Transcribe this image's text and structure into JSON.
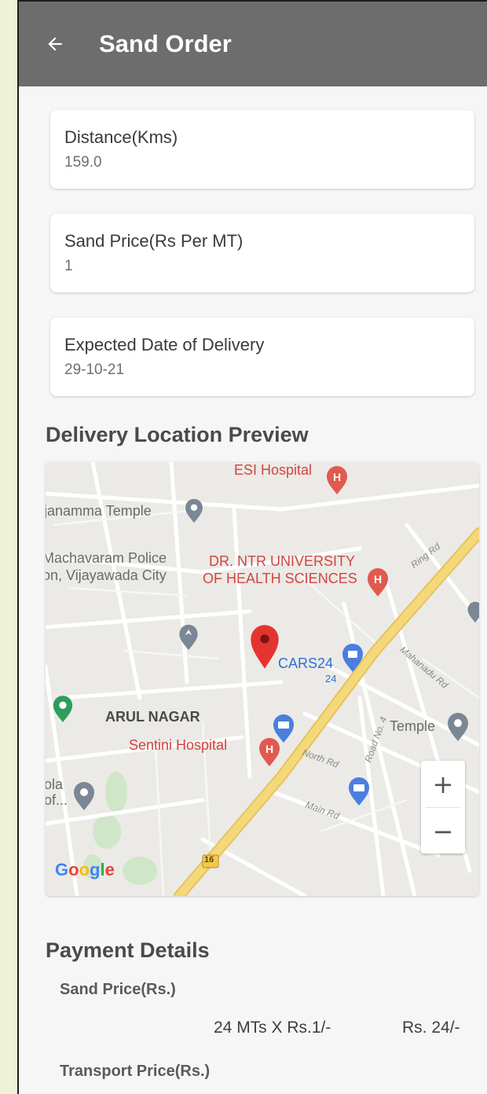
{
  "header": {
    "title": "Sand Order",
    "back_icon": "arrow-left-icon"
  },
  "cards": [
    {
      "label": "Distance(Kms)",
      "value": "159.0"
    },
    {
      "label": "Sand Price(Rs Per MT)",
      "value": "1"
    },
    {
      "label": "Expected Date of Delivery",
      "value": "29-10-21"
    }
  ],
  "map_section": {
    "title": "Delivery Location Preview",
    "labels": {
      "esi": "ESI Hospital",
      "temple1": "janamma Temple",
      "police1": "Machavaram Police",
      "police2": "on, Vijayawada City",
      "ntr1": "DR. NTR UNIVERSITY",
      "ntr2": "OF HEALTH SCIENCES",
      "cars24": "CARS24",
      "cars24_sub": "24",
      "arul": "ARUL NAGAR",
      "sentini": "Sentini Hospital",
      "temple2": "Temple",
      "kola1": "ola",
      "kola2": "of...",
      "ring_rd": "Ring Rd",
      "mahanadu_rd": "Mahanadu Rd",
      "north_rd": "North Rd",
      "road_no": "Road No. 4",
      "main_rd": "Main Rd",
      "highway": "16",
      "google": "Google"
    },
    "zoom_in": "+",
    "zoom_out": "−",
    "colors": {
      "pin": "#e5342f",
      "hospital": "#e05a4f",
      "blue_poi": "#4a7fe0",
      "green_poi": "#2e9e5b",
      "road_major": "#f4d97a"
    }
  },
  "payment": {
    "title": "Payment Details",
    "sand_label": "Sand Price(Rs.)",
    "sand_calc": "24 MTs X Rs.1/-",
    "sand_amount": "Rs. 24/-",
    "transport_label": "Transport Price(Rs.)"
  }
}
